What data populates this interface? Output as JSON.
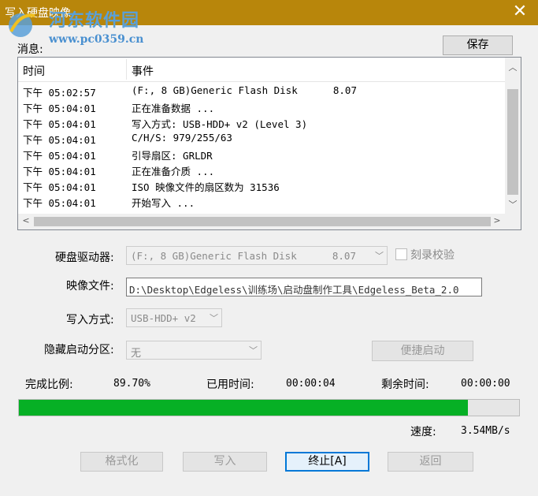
{
  "window": {
    "title": "写入硬盘映像",
    "close_glyph": "✕"
  },
  "watermark": {
    "site_name": "河东软件园",
    "url": "www.pc0359.cn"
  },
  "messages_label": "消息:",
  "save_label": "保存",
  "log": {
    "columns": [
      "时间",
      "事件"
    ],
    "rows": [
      {
        "time": "下午 05:02:57",
        "event": "(F:, 8 GB)Generic Flash Disk      8.07"
      },
      {
        "time": "下午 05:04:01",
        "event": "正在准备数据 ..."
      },
      {
        "time": "下午 05:04:01",
        "event": "写入方式: USB-HDD+ v2 (Level 3)"
      },
      {
        "time": "下午 05:04:01",
        "event": "C/H/S: 979/255/63"
      },
      {
        "time": "下午 05:04:01",
        "event": "引导扇区: GRLDR"
      },
      {
        "time": "下午 05:04:01",
        "event": "正在准备介质 ..."
      },
      {
        "time": "下午 05:04:01",
        "event": "ISO 映像文件的扇区数为 31536"
      },
      {
        "time": "下午 05:04:01",
        "event": "开始写入 ..."
      }
    ]
  },
  "drive": {
    "label": "硬盘驱动器:",
    "value": "(F:, 8 GB)Generic Flash Disk      8.07"
  },
  "verify": {
    "label": "刻录校验",
    "checked": false
  },
  "image_file": {
    "label": "映像文件:",
    "value": "D:\\Desktop\\Edgeless\\训练场\\启动盘制作工具\\Edgeless_Beta_2.0"
  },
  "write_method": {
    "label": "写入方式:",
    "value": "USB-HDD+ v2"
  },
  "hidden_partition": {
    "label": "隐藏启动分区:",
    "value": "无"
  },
  "quick_boot_label": "便捷启动",
  "status": {
    "completion_label": "完成比例:",
    "completion_value": "89.70%",
    "elapsed_label": "已用时间:",
    "elapsed_value": "00:00:04",
    "remaining_label": "剩余时间:",
    "remaining_value": "00:00:00",
    "speed_label": "速度:",
    "speed_value": "3.54MB/s"
  },
  "progress": {
    "fraction": 0.897,
    "color": "#06b025"
  },
  "buttons": {
    "format": "格式化",
    "write": "写入",
    "stop": "终止[A]",
    "back": "返回"
  },
  "icons": {
    "close": "close-icon",
    "scroll_up": "chevron-up-icon",
    "scroll_down": "chevron-down-icon",
    "scroll_left": "chevron-left-icon",
    "scroll_right": "chevron-right-icon",
    "dropdown": "chevron-down-icon"
  },
  "colors": {
    "titlebar": "#b8860b",
    "accent": "#0078d7"
  }
}
